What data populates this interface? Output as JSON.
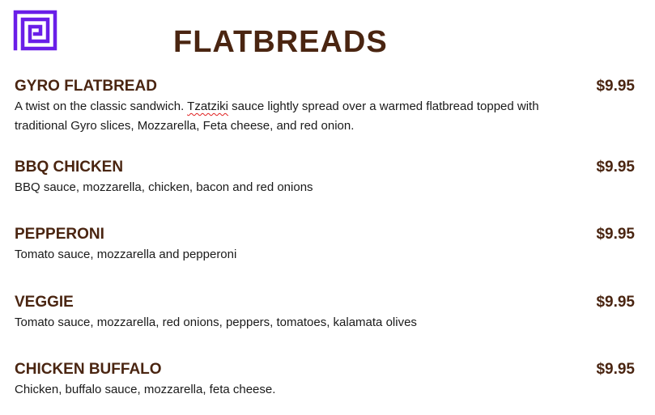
{
  "title": "FLATBREADS",
  "colors": {
    "heading": "#4a2511",
    "text": "#1a1a1a",
    "logo": "#6a1ee8",
    "spellcheck": "#e02020"
  },
  "logo": {
    "icon": "greek-key-icon"
  },
  "items": [
    {
      "name": "GYRO FLATBREAD",
      "price": "$9.95",
      "desc_before": "A twist on the classic sandwich. ",
      "desc_flagged": "Tzatziki",
      "desc_after": " sauce lightly spread over a warmed flatbread topped with traditional Gyro slices, Mozzarella, Feta cheese, and red onion."
    },
    {
      "name": "BBQ CHICKEN",
      "price": "$9.95",
      "desc": "BBQ sauce, mozzarella, chicken, bacon and red onions"
    },
    {
      "name": "PEPPERONI",
      "price": "$9.95",
      "desc": "Tomato sauce, mozzarella and pepperoni"
    },
    {
      "name": "VEGGIE",
      "price": "$9.95",
      "desc": "Tomato sauce, mozzarella, red onions, peppers, tomatoes, kalamata olives"
    },
    {
      "name": "CHICKEN BUFFALO",
      "price": "$9.95",
      "desc": "Chicken, buffalo sauce, mozzarella, feta cheese."
    }
  ]
}
